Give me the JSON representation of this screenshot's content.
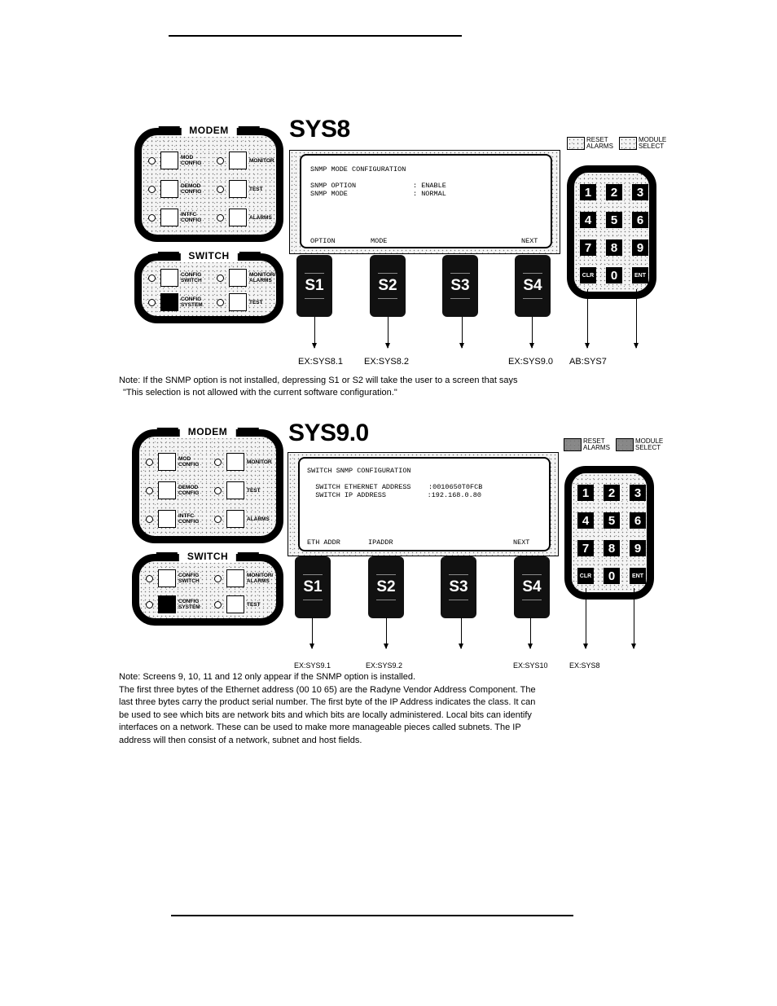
{
  "page": {
    "header_rule": true,
    "footer_rule": true
  },
  "diagrams": [
    {
      "title": "SYS8",
      "modem_panel": {
        "title": "MODEM",
        "buttons": [
          {
            "label": "MOD CONFIG"
          },
          {
            "label": "MONITOR"
          },
          {
            "label": "DEMOD CONFIG"
          },
          {
            "label": "TEST"
          },
          {
            "label": "INTFC CONFIG"
          },
          {
            "label": "ALARMS"
          }
        ]
      },
      "switch_panel": {
        "title": "SWITCH",
        "buttons": [
          {
            "label": "CONFIG SWITCH",
            "active": false
          },
          {
            "label": "MONITOR/ ALARMS",
            "active": false
          },
          {
            "label": "CONFIG SYSTEM",
            "active": true
          },
          {
            "label": "TEST",
            "active": false
          }
        ]
      },
      "lcd": {
        "heading": "SNMP MODE CONFIGURATION",
        "rows": [
          {
            "label": "SNMP OPTION",
            "value": ": ENABLE"
          },
          {
            "label": "SNMP MODE",
            "value": ": NORMAL"
          }
        ],
        "softkeys": [
          "OPTION",
          "MODE",
          "",
          "NEXT"
        ]
      },
      "legend": [
        {
          "label": "RESET ALARMS",
          "icon": "reset-alarms-icon"
        },
        {
          "label": "MODULE SELECT",
          "icon": "module-select-icon"
        }
      ],
      "keypad": [
        "1",
        "2",
        "3",
        "4",
        "5",
        "6",
        "7",
        "8",
        "9",
        "CLR",
        "0",
        "ENT"
      ],
      "softkey_buttons": [
        "S1",
        "S2",
        "S3",
        "S4"
      ],
      "destinations": [
        "EX:SYS8.1",
        "EX:SYS8.2",
        "",
        "EX:SYS9.0",
        "AB:SYS7",
        ""
      ],
      "note": [
        "Note:  If the SNMP option is not installed, depressing S1 or S2 will take the user to a screen that says",
        "\"This selection is not allowed with the current software configuration.\""
      ]
    },
    {
      "title": "SYS9.0",
      "modem_panel": {
        "title": "MODEM",
        "buttons": [
          {
            "label": "MOD CONFIG"
          },
          {
            "label": "MONITOR"
          },
          {
            "label": "DEMOD CONFIG"
          },
          {
            "label": "TEST"
          },
          {
            "label": "INTFC CONFIG"
          },
          {
            "label": "ALARMS"
          }
        ]
      },
      "switch_panel": {
        "title": "SWITCH",
        "buttons": [
          {
            "label": "CONFIG SWITCH",
            "active": false
          },
          {
            "label": "MONITOR/ ALARMS",
            "active": false
          },
          {
            "label": "CONFIG SYSTEM",
            "active": true
          },
          {
            "label": "TEST",
            "active": false
          }
        ]
      },
      "lcd": {
        "heading": "SWITCH SNMP CONFIGURATION",
        "rows": [
          {
            "label": "  SWITCH ETHERNET ADDRESS",
            "value": ":0010650T0FCB"
          },
          {
            "label": "  SWITCH IP ADDRESS",
            "value": "      :192.168.0.80"
          }
        ],
        "softkeys": [
          "ETH ADDR",
          "IPADDR",
          "",
          "NEXT"
        ]
      },
      "legend": [
        {
          "label": "RESET ALARMS",
          "icon": "reset-alarms-icon"
        },
        {
          "label": "MODULE SELECT",
          "icon": "module-select-icon"
        }
      ],
      "keypad": [
        "1",
        "2",
        "3",
        "4",
        "5",
        "6",
        "7",
        "8",
        "9",
        "CLR",
        "0",
        "ENT"
      ],
      "softkey_buttons": [
        "S1",
        "S2",
        "S3",
        "S4"
      ],
      "destinations": [
        "EX:SYS9.1",
        "EX:SYS9.2",
        "",
        "EX:SYS10",
        "EX:SYS8",
        ""
      ],
      "note": [
        "Note: Screens 9, 10, 11 and 12 only appear if the SNMP option is installed.",
        "The first three bytes of the Ethernet address (00 10 65) are the Radyne Vendor Address Component. The",
        "last three bytes carry the product serial number.  The first byte of the IP Address indicates the class. It can",
        "be used to see which bits are network bits and which bits are locally administered.  Local bits can identify",
        "interfaces on a network. These can be used to make more manageable pieces called subnets. The IP",
        "address will then consist of a network, subnet and host fields."
      ]
    }
  ]
}
